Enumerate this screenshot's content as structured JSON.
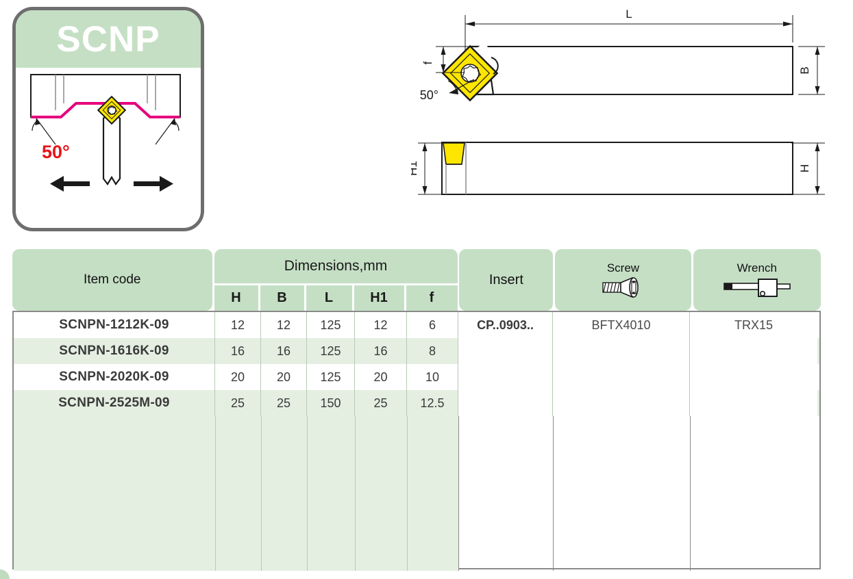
{
  "product_card": {
    "title": "SCNP",
    "angle_label": "50°",
    "icons": {
      "insert": "diamond-insert-icon",
      "left_arrow": "arrow-left-icon",
      "right_arrow": "arrow-right-icon"
    }
  },
  "drawings": {
    "top_view": {
      "length_label": "L",
      "width_label": "B",
      "offset_label": "f",
      "angle_label": "50°"
    },
    "side_view": {
      "insert_height_label": "H1",
      "shank_height_label": "H"
    }
  },
  "table": {
    "headers": {
      "item_code": "Item code",
      "dimensions_group": "Dimensions,mm",
      "dims": [
        "H",
        "B",
        "L",
        "H1",
        "f"
      ],
      "insert": "Insert",
      "screw": "Screw",
      "wrench": "Wrench"
    },
    "icons": {
      "screw": "screw-icon",
      "wrench": "t-wrench-icon"
    },
    "rows": [
      {
        "code": "SCNPN-1212K-09",
        "H": "12",
        "B": "12",
        "L": "125",
        "H1": "12",
        "f": "6",
        "insert": "CP..0903..",
        "screw": "BFTX4010",
        "wrench": "TRX15"
      },
      {
        "code": "SCNPN-1616K-09",
        "H": "16",
        "B": "16",
        "L": "125",
        "H1": "16",
        "f": "8",
        "insert": "",
        "screw": "",
        "wrench": ""
      },
      {
        "code": "SCNPN-2020K-09",
        "H": "20",
        "B": "20",
        "L": "125",
        "H1": "20",
        "f": "10",
        "insert": "",
        "screw": "",
        "wrench": ""
      },
      {
        "code": "SCNPN-2525M-09",
        "H": "25",
        "B": "25",
        "L": "150",
        "H1": "25",
        "f": "12.5",
        "insert": "",
        "screw": "",
        "wrench": ""
      }
    ]
  },
  "colors": {
    "header_green": "#c5dfc5",
    "row_green": "#e4efe2",
    "insert_yellow": "#ffe600",
    "cut_magenta": "#e6007e",
    "angle_red": "#e8151b",
    "border_gray": "#6e6e6e"
  }
}
